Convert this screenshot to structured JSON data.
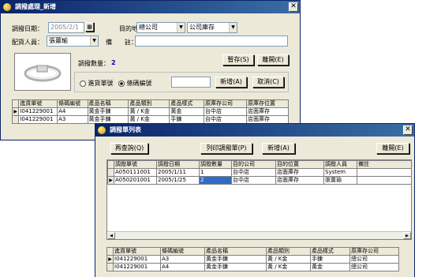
{
  "transfer_window": {
    "title": "調撥處理_新增",
    "date_label": "調撥日期：",
    "date_value": "2005/2/1",
    "dest_label": "目的地：",
    "dest_company": "總公司",
    "dest_location": "公司庫存",
    "staff_label": "配貨人員：",
    "staff_value": "張薑瑜",
    "memo_label": "備　　註：",
    "memo_value": "",
    "qty_label": "調撥數量：",
    "qty_value": "2",
    "save_btn": "暫存(S)",
    "exit_btn": "離開(E)",
    "radio_purchase": "進貨單號",
    "radio_barcode": "條碼編號",
    "code_value": "",
    "add_btn": "新增(A)",
    "cancel_btn": "取消(C)",
    "grid_headers": [
      "進貨單號",
      "條碼編號",
      "產品名稱",
      "產品類別",
      "產品樣式",
      "原庫存公司",
      "原庫存位置"
    ],
    "grid_rows": [
      [
        "I041229001",
        "A4",
        "黃金手鍊",
        "黃 / K金",
        "黃金",
        "台中店",
        "店面庫存"
      ],
      [
        "I041229001",
        "A3",
        "黃金手鍊",
        "黃 / K金",
        "手鍊",
        "台中店",
        "店面庫存"
      ]
    ]
  },
  "list_window": {
    "title": "調撥單列表",
    "query_btn": "再查詢(Q)",
    "print_btn": "列印調撥單(P)",
    "add_btn": "新增(A)",
    "exit_btn": "離開(E)",
    "top_headers": [
      "調撥單號",
      "調撥日期",
      "調撥數量",
      "目的公司",
      "目的位置",
      "調撥人員",
      "備註"
    ],
    "top_rows": [
      [
        "A050111001",
        "2005/1/11",
        "1",
        "台中店",
        "店面庫存",
        "System",
        ""
      ],
      [
        "A050201001",
        "2005/1/25",
        "2",
        "台中店",
        "店面庫存",
        "張薑瑜",
        ""
      ]
    ],
    "bottom_headers": [
      "進貨單號",
      "條碼編號",
      "產品名稱",
      "產品類別",
      "產品樣式",
      "原庫存公司"
    ],
    "bottom_rows": [
      [
        "I041229001",
        "A3",
        "黃金手鍊",
        "黃 / K金",
        "手鍊",
        "總公司"
      ],
      [
        "I041229001",
        "A4",
        "黃金手鍊",
        "黃 / K金",
        "黃金",
        "總公司"
      ]
    ]
  }
}
